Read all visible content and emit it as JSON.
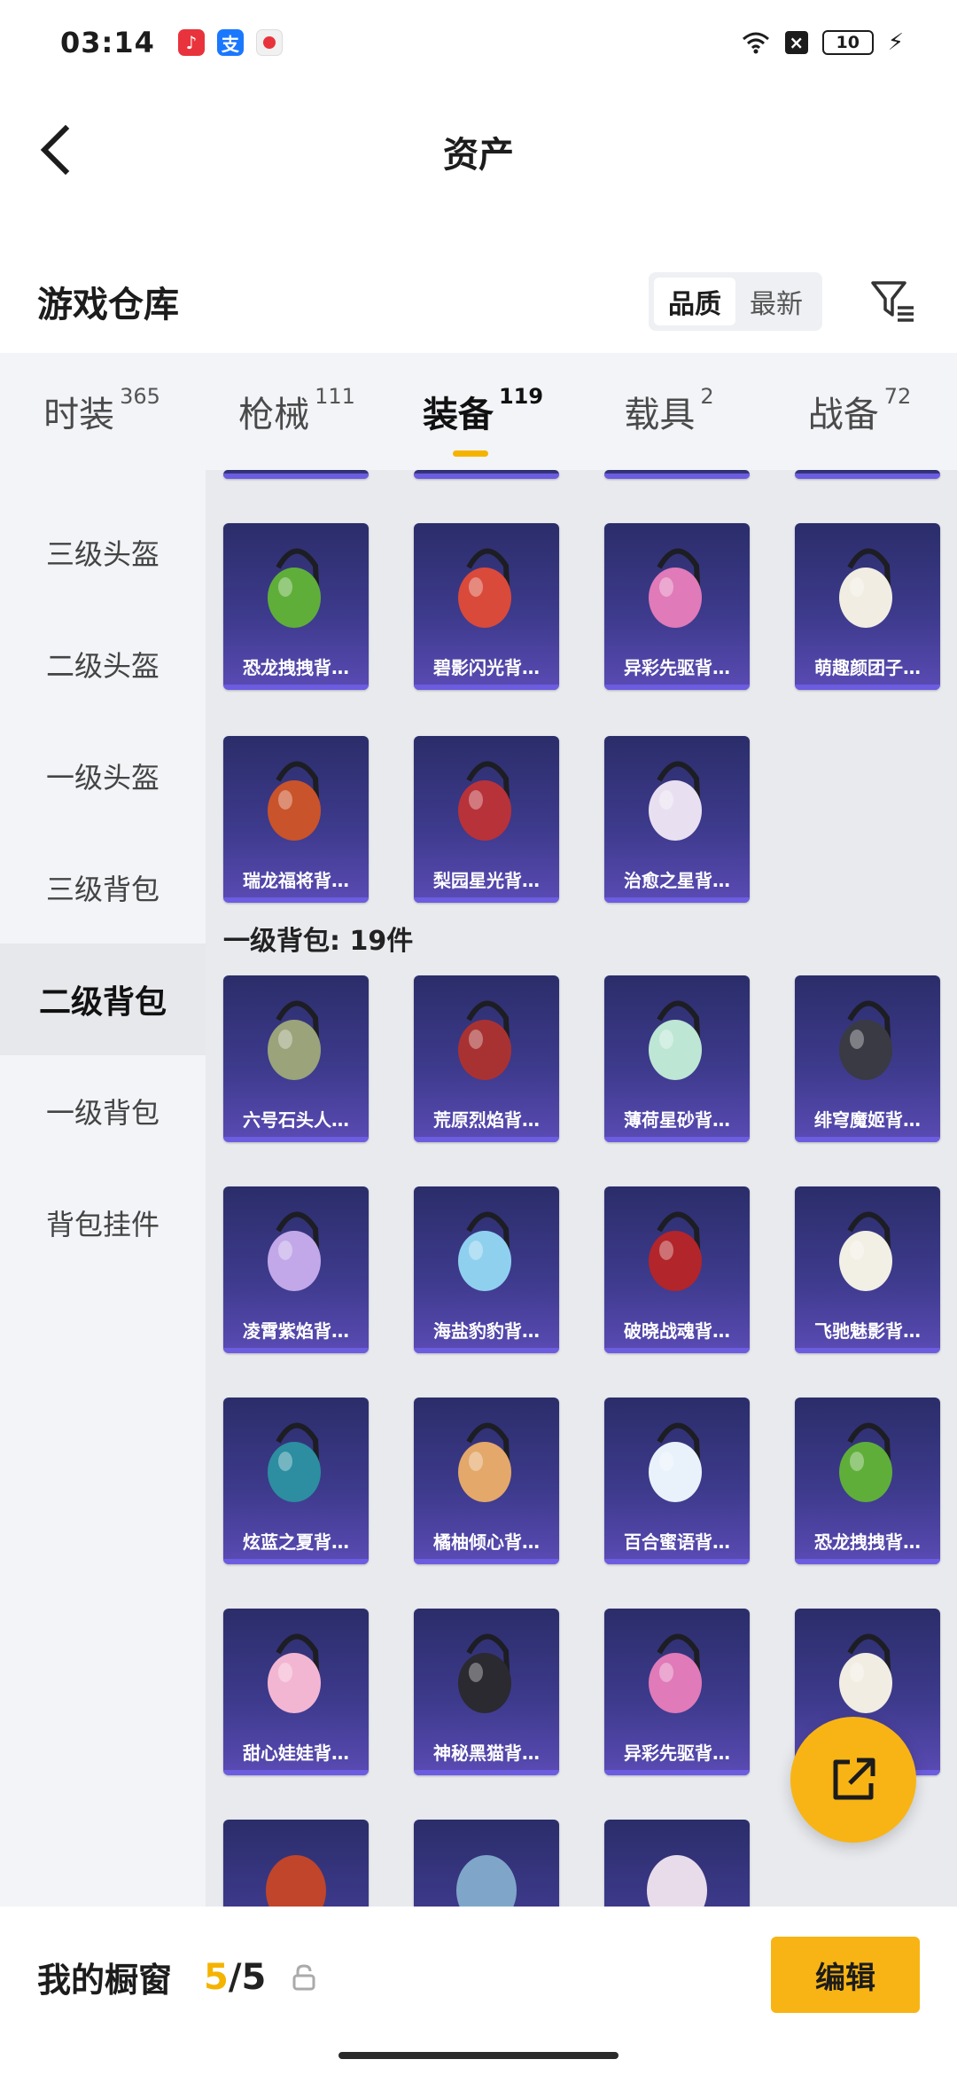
{
  "status_bar": {
    "time": "03:14",
    "battery": "10"
  },
  "header": {
    "title": "资产"
  },
  "warehouse": {
    "title": "游戏仓库",
    "sort_options": [
      "品质",
      "最新"
    ],
    "active_sort": "品质"
  },
  "tabs": [
    {
      "label": "时装",
      "count": "365"
    },
    {
      "label": "枪械",
      "count": "111"
    },
    {
      "label": "装备",
      "count": "119",
      "active": true
    },
    {
      "label": "载具",
      "count": "2"
    },
    {
      "label": "战备",
      "count": "72"
    }
  ],
  "sidebar": [
    {
      "label": "三级头盔"
    },
    {
      "label": "二级头盔"
    },
    {
      "label": "一级头盔"
    },
    {
      "label": "三级背包"
    },
    {
      "label": "二级背包",
      "active": true
    },
    {
      "label": "一级背包"
    },
    {
      "label": "背包挂件"
    }
  ],
  "grid_upper": [
    {
      "name": "恐龙拽拽背…",
      "icon": "dino-backpack-icon",
      "color": "#5fae3a"
    },
    {
      "name": "碧影闪光背…",
      "icon": "gamepad-backpack-icon",
      "color": "#d94a3a"
    },
    {
      "name": "异彩先驱背…",
      "icon": "pink-backpack-icon",
      "color": "#e07ab8"
    },
    {
      "name": "萌趣颜团子…",
      "icon": "bunny-backpack-icon",
      "color": "#f1ede2"
    },
    {
      "name": "瑞龙福将背…",
      "icon": "dragon-backpack-icon",
      "color": "#c9532a"
    },
    {
      "name": "梨园星光背…",
      "icon": "opera-backpack-icon",
      "color": "#b8323a"
    },
    {
      "name": "治愈之星背…",
      "icon": "white-backpack-icon",
      "color": "#e8e0f0"
    }
  ],
  "section": {
    "label": "一级背包: 19件"
  },
  "grid_lower": [
    {
      "name": "六号石头人…",
      "icon": "stone-backpack-icon",
      "color": "#9aa37a"
    },
    {
      "name": "荒原烈焰背…",
      "icon": "flame-backpack-icon",
      "color": "#a83232"
    },
    {
      "name": "薄荷星砂背…",
      "icon": "mint-backpack-icon",
      "color": "#bde6d4"
    },
    {
      "name": "绯穹魔姬背…",
      "icon": "dark-backpack-icon",
      "color": "#3a3a44"
    },
    {
      "name": "凌霄紫焰背…",
      "icon": "purple-backpack-icon",
      "color": "#c2a8e8"
    },
    {
      "name": "海盐豹豹背…",
      "icon": "seal-backpack-icon",
      "color": "#8fd0ef"
    },
    {
      "name": "破晓战魂背…",
      "icon": "armor-backpack-icon",
      "color": "#b2252a"
    },
    {
      "name": "飞驰魅影背…",
      "icon": "racer-backpack-icon",
      "color": "#f2efe4"
    },
    {
      "name": "炫蓝之夏背…",
      "icon": "teal-backpack-icon",
      "color": "#2c8ea0"
    },
    {
      "name": "橘柚倾心背…",
      "icon": "ball-backpack-icon",
      "color": "#e3a86a"
    },
    {
      "name": "百合蜜语背…",
      "icon": "lily-backpack-icon",
      "color": "#e9f2fb"
    },
    {
      "name": "恐龙拽拽背…",
      "icon": "dino-backpack-icon",
      "color": "#5fae3a"
    },
    {
      "name": "甜心娃娃背…",
      "icon": "candy-backpack-icon",
      "color": "#f3b6d2"
    },
    {
      "name": "神秘黑猫背…",
      "icon": "cat-backpack-icon",
      "color": "#2a2a30"
    },
    {
      "name": "异彩先驱背…",
      "icon": "pink-backpack-icon",
      "color": "#e07ab8"
    },
    {
      "name": "",
      "icon": "bunny-backpack-icon",
      "color": "#f1ede2"
    }
  ],
  "bottom": {
    "showcase_label": "我的橱窗",
    "current": "5",
    "separator": "/",
    "max": "5",
    "edit_label": "编辑"
  },
  "colors": {
    "accent": "#f5b300",
    "card_bg": "#3d3a8c"
  }
}
